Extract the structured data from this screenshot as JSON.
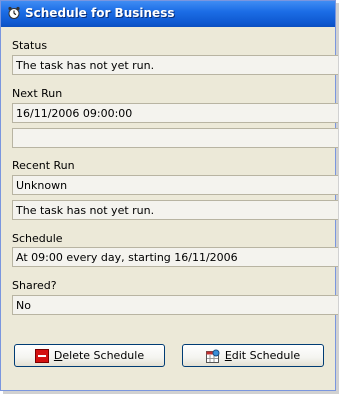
{
  "window": {
    "title": "Schedule for Business"
  },
  "fields": [
    {
      "label": "Status",
      "values": [
        "The task has not yet run."
      ]
    },
    {
      "label": "Next Run",
      "values": [
        "16/11/2006 09:00:00",
        ""
      ]
    },
    {
      "label": "Recent Run",
      "values": [
        "Unknown",
        "The task has not yet run."
      ]
    },
    {
      "label": "Schedule",
      "values": [
        "At 09:00 every day, starting 16/11/2006"
      ]
    },
    {
      "label": "Shared?",
      "values": [
        "No"
      ]
    }
  ],
  "buttons": {
    "delete": {
      "mnemonic": "D",
      "rest": "elete Schedule",
      "icon": "delete-icon"
    },
    "edit": {
      "mnemonic": "E",
      "rest": "dit Schedule",
      "icon": "edit-calendar-icon"
    }
  },
  "colors": {
    "titlebar": "#0e58d0",
    "window_bg": "#ece9d8",
    "field_bg": "#f4f3ee"
  }
}
